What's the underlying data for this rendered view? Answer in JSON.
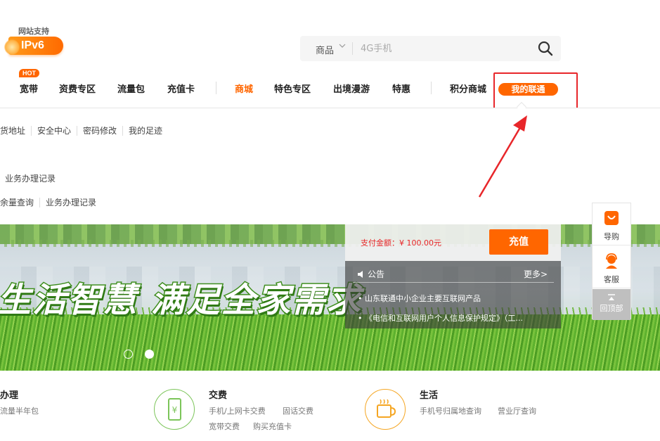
{
  "header": {
    "ipv6_caption": "网站支持",
    "ipv6_label": "IPv6",
    "search": {
      "category": "商品",
      "placeholder": "4G手机"
    }
  },
  "nav": {
    "hot_badge": "HOT",
    "items": [
      {
        "label": "宽带"
      },
      {
        "label": "资费专区"
      },
      {
        "label": "流量包"
      },
      {
        "label": "充值卡"
      },
      {
        "label": "商城",
        "active": true
      },
      {
        "label": "特色专区"
      },
      {
        "label": "出境漫游"
      },
      {
        "label": "特惠"
      },
      {
        "label": "积分商城"
      },
      {
        "label": "我的联通",
        "highlighted": true
      }
    ]
  },
  "dropdown": {
    "row1": [
      "货地址",
      "安全中心",
      "密码修改",
      "我的足迹"
    ],
    "row2": [
      "业务办理记录"
    ],
    "row3": [
      "余量查询",
      "业务办理记录"
    ]
  },
  "banner": {
    "slogan": "生活智慧 满足全家需求",
    "active_slide": 2,
    "slide_count": 2
  },
  "recharge": {
    "pay_amount": "支付金额：¥ 100.00元",
    "button": "充值"
  },
  "notice": {
    "title": "公告",
    "more": "更多>",
    "items": [
      "• 山东联通中小企业主要互联网产品",
      "• 《电信和互联网用户个人信息保护规定》（工..."
    ]
  },
  "side_tool": {
    "guide": "导购",
    "service": "客服",
    "top": "回顶部"
  },
  "services": [
    {
      "title": "办理",
      "links": [
        "流量半年包"
      ]
    },
    {
      "title": "交费",
      "links": [
        "手机/上网卡交费",
        "固话交费",
        "宽带交费",
        "购买充值卡"
      ]
    },
    {
      "title": "生活",
      "links": [
        "手机号归属地查询",
        "营业厅查询"
      ]
    }
  ],
  "colors": {
    "brand_orange": "#ff6600",
    "annotation_red": "#e8262a",
    "service_green": "#7cc55a",
    "service_orange": "#f5a623"
  }
}
